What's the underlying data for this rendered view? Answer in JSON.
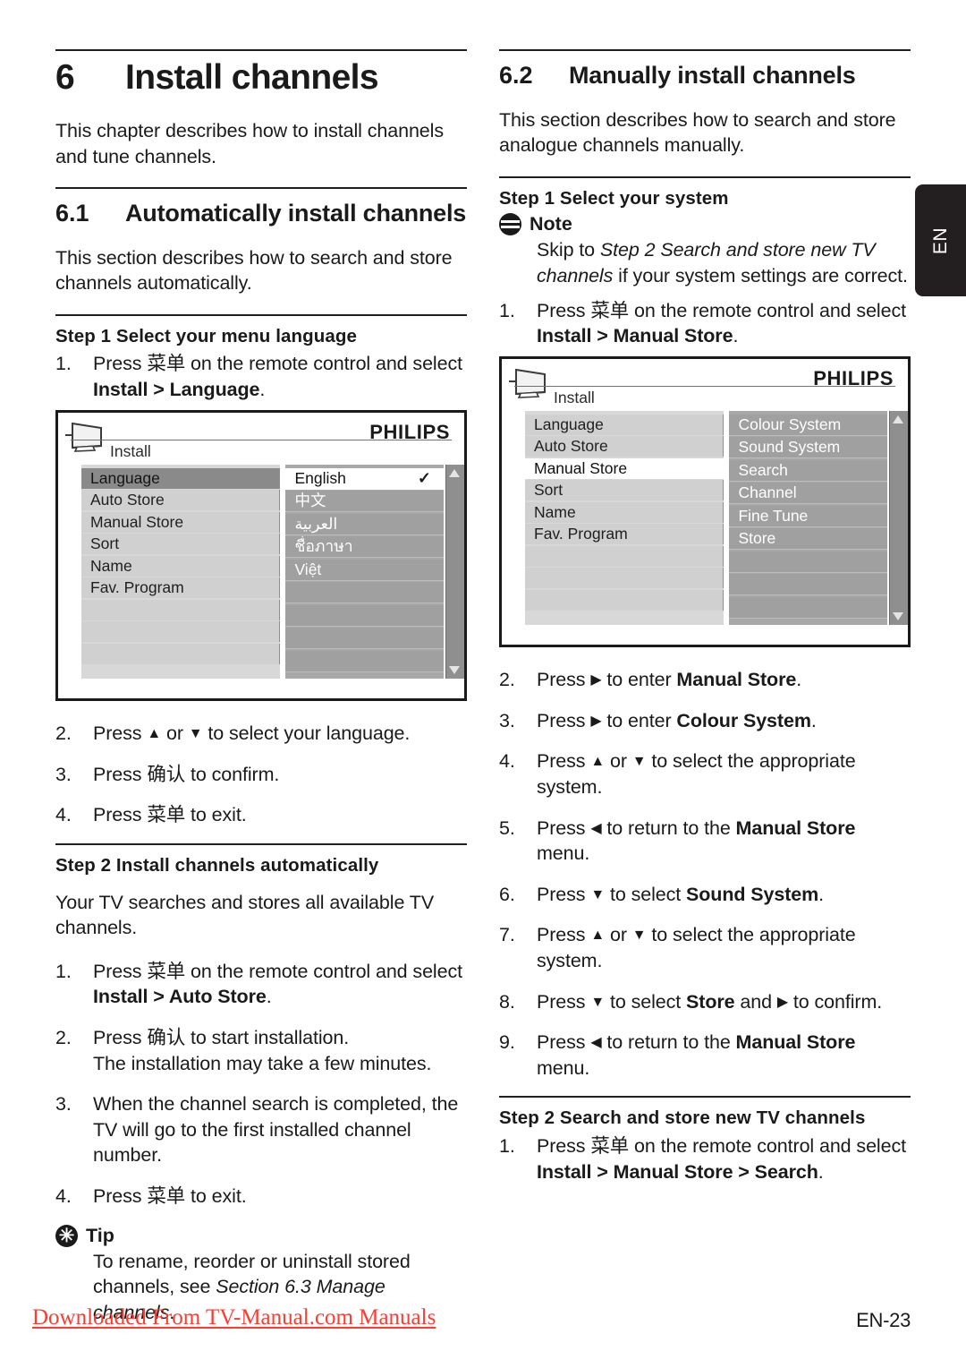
{
  "sidetab": {
    "label": "EN"
  },
  "footer": {
    "link": "Downloaded From TV-Manual.com Manuals",
    "page": "EN-23"
  },
  "left_column": {
    "chapter": {
      "number": "6",
      "title": "Install channels"
    },
    "chapter_intro": "This chapter describes how to install channels and tune channels.",
    "section_61": {
      "number": "6.1",
      "title": "Automatically install channels"
    },
    "section_61_intro": "This section describes how to search and store channels automatically.",
    "step1_heading": "Step 1 Select your menu language",
    "step1_items": [
      {
        "num": "1.",
        "pre": "Press ",
        "key": "菜单",
        "mid": " on the remote control and select ",
        "bold": "Install > Language",
        "post": "."
      }
    ],
    "step1_after": [
      {
        "num": "2.",
        "pre": "Press ",
        "arrow_up": "▲",
        "mid": " or ",
        "arrow_down": "▼",
        "post": " to select your language."
      },
      {
        "num": "3.",
        "pre": "Press ",
        "key": "确认",
        "post": " to confirm."
      },
      {
        "num": "4.",
        "pre": "Press ",
        "key": "菜单",
        "post": " to exit."
      }
    ],
    "step2_heading": "Step 2 Install channels automatically",
    "step2_intro": "Your TV searches and stores all available TV channels.",
    "step2_items": [
      {
        "num": "1.",
        "pre": "Press ",
        "key": "菜单",
        "mid": " on the remote control and select ",
        "bold": "Install > Auto Store",
        "post": "."
      },
      {
        "num": "2.",
        "pre": "Press ",
        "key": "确认",
        "post": " to start installation.",
        "line2": "The installation may take a few minutes."
      },
      {
        "num": "3.",
        "text": "When the channel search is completed, the TV will go to the first installed channel number."
      },
      {
        "num": "4.",
        "pre": "Press ",
        "key": "菜单",
        "post": " to exit."
      }
    ],
    "tip": {
      "icon": "tip-icon",
      "title": "Tip",
      "body_plain": "To rename, reorder or uninstall stored channels, see ",
      "body_italic": "Section 6.3 Manage channels",
      "body_end": "."
    }
  },
  "right_column": {
    "section_62": {
      "number": "6.2",
      "title": "Manually install channels"
    },
    "section_62_intro": "This section describes how to search and store analogue channels manually.",
    "step1_heading": "Step 1 Select your system",
    "note": {
      "icon": "note-icon",
      "title": "Note",
      "body_plain": "Skip to ",
      "body_italic": "Step 2 Search and store new TV channels",
      "body_end": " if your system settings are correct."
    },
    "step1_items": [
      {
        "num": "1.",
        "pre": "Press ",
        "key": "菜单",
        "mid": " on the remote control and select ",
        "bold": "Install > Manual Store",
        "post": "."
      }
    ],
    "steps_after_shot": [
      {
        "num": "2.",
        "pre": "Press ",
        "arrow": "▶",
        "mid": " to enter ",
        "bold": "Manual Store",
        "post": "."
      },
      {
        "num": "3.",
        "pre": "Press ",
        "arrow": "▶",
        "mid": " to enter ",
        "bold": "Colour System",
        "post": "."
      },
      {
        "num": "4.",
        "pre": "Press ",
        "arrow_up": "▲",
        "mid": " or ",
        "arrow_down": "▼",
        "post": " to select the appropriate system."
      },
      {
        "num": "5.",
        "pre": "Press ",
        "arrow": "◀",
        "mid": " to return to the ",
        "bold": "Manual Store",
        "post": " menu."
      },
      {
        "num": "6.",
        "pre": "Press ",
        "arrow_down": "▼",
        "mid": " to select ",
        "bold": "Sound System",
        "post": "."
      },
      {
        "num": "7.",
        "pre": "Press ",
        "arrow_up": "▲",
        "mid": " or ",
        "arrow_down": "▼",
        "post": " to select the appropriate system."
      },
      {
        "num": "8.",
        "pre": "Press ",
        "arrow_down": "▼",
        "mid": " to select ",
        "bold": "Store",
        "mid2": " and ",
        "arrow2": "▶",
        "post": " to confirm."
      },
      {
        "num": "9.",
        "pre": "Press ",
        "arrow": "◀",
        "mid": " to return to the ",
        "bold": "Manual Store",
        "post": " menu."
      }
    ],
    "step2_heading": "Step 2 Search and store new TV channels",
    "step2_items": [
      {
        "num": "1.",
        "pre": "Press ",
        "key": "菜单",
        "mid": " on the remote control and select ",
        "bold": "Install > Manual Store > Search",
        "post": "."
      }
    ]
  },
  "tv_menu_language": {
    "brand": "PHILIPS",
    "breadcrumb": "Install",
    "left_items": [
      {
        "label": "Language",
        "state": "selected-grey"
      },
      {
        "label": "Auto Store",
        "state": "normal"
      },
      {
        "label": "Manual Store",
        "state": "normal"
      },
      {
        "label": "Sort",
        "state": "normal"
      },
      {
        "label": "Name",
        "state": "normal"
      },
      {
        "label": "Fav. Program",
        "state": "normal"
      },
      {
        "label": "",
        "state": "blank"
      },
      {
        "label": "",
        "state": "blank"
      },
      {
        "label": "",
        "state": "blank"
      }
    ],
    "right_items": [
      {
        "label": "English",
        "state": "selected-white",
        "check": "✓"
      },
      {
        "label": "中文",
        "state": "normal"
      },
      {
        "label": "العربية",
        "state": "normal"
      },
      {
        "label": "ชื่อภาษา",
        "state": "normal"
      },
      {
        "label": "Việt",
        "state": "normal"
      },
      {
        "label": "",
        "state": "blank"
      },
      {
        "label": "",
        "state": "blank"
      },
      {
        "label": "",
        "state": "blank"
      },
      {
        "label": "",
        "state": "blank"
      }
    ]
  },
  "tv_menu_manual_store": {
    "brand": "PHILIPS",
    "breadcrumb": "Install",
    "left_items": [
      {
        "label": "Language",
        "state": "normal"
      },
      {
        "label": "Auto Store",
        "state": "normal"
      },
      {
        "label": "Manual Store",
        "state": "selected-white"
      },
      {
        "label": "Sort",
        "state": "normal"
      },
      {
        "label": "Name",
        "state": "normal"
      },
      {
        "label": "Fav. Program",
        "state": "normal"
      },
      {
        "label": "",
        "state": "blank"
      },
      {
        "label": "",
        "state": "blank"
      },
      {
        "label": "",
        "state": "blank"
      }
    ],
    "right_items": [
      {
        "label": "Colour System",
        "state": "normal"
      },
      {
        "label": "Sound System",
        "state": "normal"
      },
      {
        "label": "Search",
        "state": "normal"
      },
      {
        "label": "Channel",
        "state": "normal"
      },
      {
        "label": "Fine Tune",
        "state": "normal"
      },
      {
        "label": "Store",
        "state": "normal"
      },
      {
        "label": "",
        "state": "blank"
      },
      {
        "label": "",
        "state": "blank"
      },
      {
        "label": "",
        "state": "blank"
      }
    ]
  },
  "colors": {
    "ink": "#231f20",
    "link_red": "#ff3b30",
    "menu_left_bg": "#d0d0d0",
    "menu_right_bg": "#a0a0a0",
    "menu_selected_grey": "#8a8a8a"
  }
}
